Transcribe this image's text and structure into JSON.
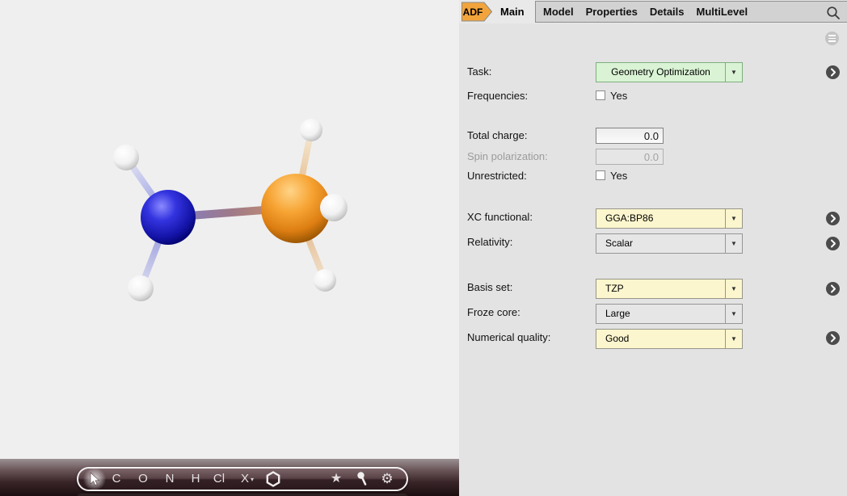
{
  "tabbar": {
    "adf": "ADF",
    "main": "Main",
    "group": [
      "Model",
      "Properties",
      "Details",
      "MultiLevel"
    ]
  },
  "form": {
    "task": {
      "label": "Task:",
      "value": "Geometry Optimization"
    },
    "frequencies": {
      "label": "Frequencies:",
      "checkbox_label": "Yes",
      "checked": false
    },
    "total_charge": {
      "label": "Total charge:",
      "value": "0.0"
    },
    "spin_polarization": {
      "label": "Spin polarization:",
      "value": "0.0",
      "disabled": true
    },
    "unrestricted": {
      "label": "Unrestricted:",
      "checkbox_label": "Yes",
      "checked": false
    },
    "xc_functional": {
      "label": "XC functional:",
      "value": "GGA:BP86"
    },
    "relativity": {
      "label": "Relativity:",
      "value": "Scalar"
    },
    "basis_set": {
      "label": "Basis set:",
      "value": "TZP"
    },
    "froze_core": {
      "label": "Froze core:",
      "value": "Large"
    },
    "numerical_quality": {
      "label": "Numerical quality:",
      "value": "Good"
    }
  },
  "toolbar": {
    "elements": [
      "C",
      "O",
      "N",
      "H",
      "Cl",
      "X"
    ],
    "icons": {
      "star": "★",
      "gear": "⚙",
      "caret": "▾"
    }
  },
  "ui": {
    "dropdown_caret": "▼"
  },
  "molecule": {
    "atoms": [
      {
        "element": "N",
        "color": "#2a2ad0"
      },
      {
        "element": "P",
        "color": "#f09a28"
      },
      {
        "element": "H",
        "color": "#ffffff"
      },
      {
        "element": "H",
        "color": "#ffffff"
      },
      {
        "element": "H",
        "color": "#ffffff"
      },
      {
        "element": "H",
        "color": "#ffffff"
      },
      {
        "element": "H",
        "color": "#ffffff"
      }
    ]
  },
  "colors": {
    "adf_badge": "#f2a43c",
    "task_field_bg": "#d9f3d4",
    "task_field_border": "#7fae7f",
    "yellow_field_bg": "#fcf6ce",
    "gray_field_bg": "#e6e6e6",
    "panel_bg": "#e3e3e3",
    "viewer_bg": "#efefef"
  }
}
